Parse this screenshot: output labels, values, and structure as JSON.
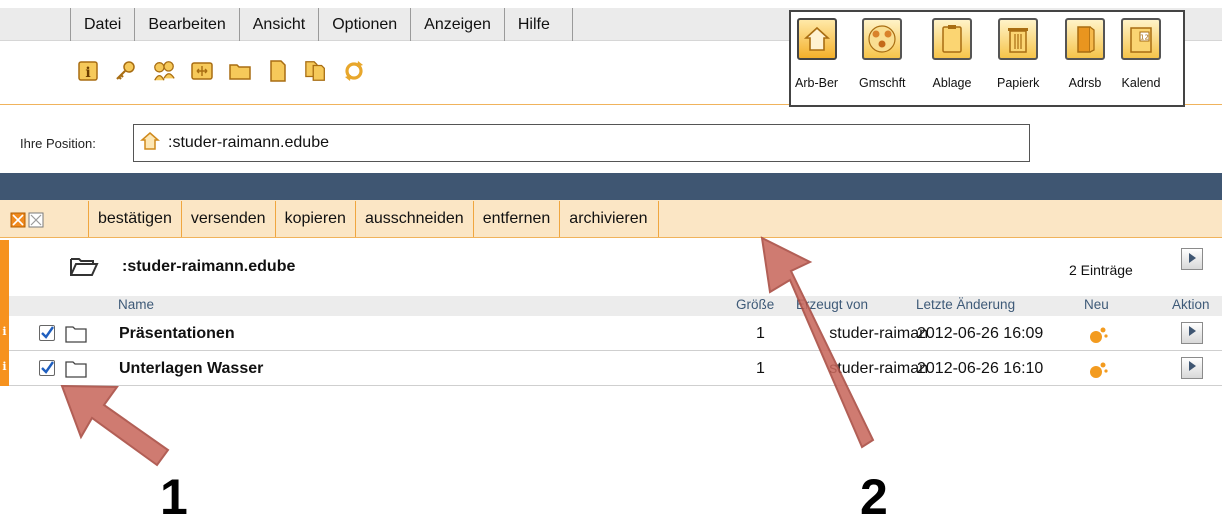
{
  "menu": [
    "Datei",
    "Bearbeiten",
    "Ansicht",
    "Optionen",
    "Anzeigen",
    "Hilfe"
  ],
  "tools": [
    "info-icon",
    "key-icon",
    "users-icon",
    "move-icon",
    "folder-icon",
    "document-icon",
    "copy-documents-icon",
    "refresh-icon"
  ],
  "apps": [
    {
      "label": "Arb-Ber",
      "icon": "home-icon"
    },
    {
      "label": "Gmschft",
      "icon": "community-icon"
    },
    {
      "label": "Ablage",
      "icon": "clipboard-icon"
    },
    {
      "label": "Papierk",
      "icon": "trash-icon"
    },
    {
      "label": "Adrsb",
      "icon": "address-book-icon"
    },
    {
      "label": "Kalend",
      "icon": "calendar-icon"
    }
  ],
  "position": {
    "label": "Ihre Position:",
    "path": ":studer-raimann.edube"
  },
  "actions": [
    "bestätigen",
    "versenden",
    "kopieren",
    "ausschneiden",
    "entfernen",
    "archivieren"
  ],
  "folder": {
    "title": ":studer-raimann.edube",
    "entries": "2 Einträge"
  },
  "columns": {
    "name": "Name",
    "size": "Größe",
    "created_by": "Erzeugt von",
    "last_change": "Letzte Änderung",
    "new": "Neu",
    "action": "Aktion"
  },
  "rows": [
    {
      "name": "Präsentationen",
      "count": "1",
      "author": "studer-raiman",
      "date": "2012-06-26 16:09",
      "checked": true
    },
    {
      "name": "Unterlagen Wasser",
      "count": "1",
      "author": "studer-raiman",
      "date": "2012-06-26 16:10",
      "checked": true
    }
  ],
  "annotations": {
    "one": "1",
    "two": "2"
  },
  "colors": {
    "accent": "#f6921e",
    "band": "#3f5672",
    "arrow": "#c9695e"
  }
}
